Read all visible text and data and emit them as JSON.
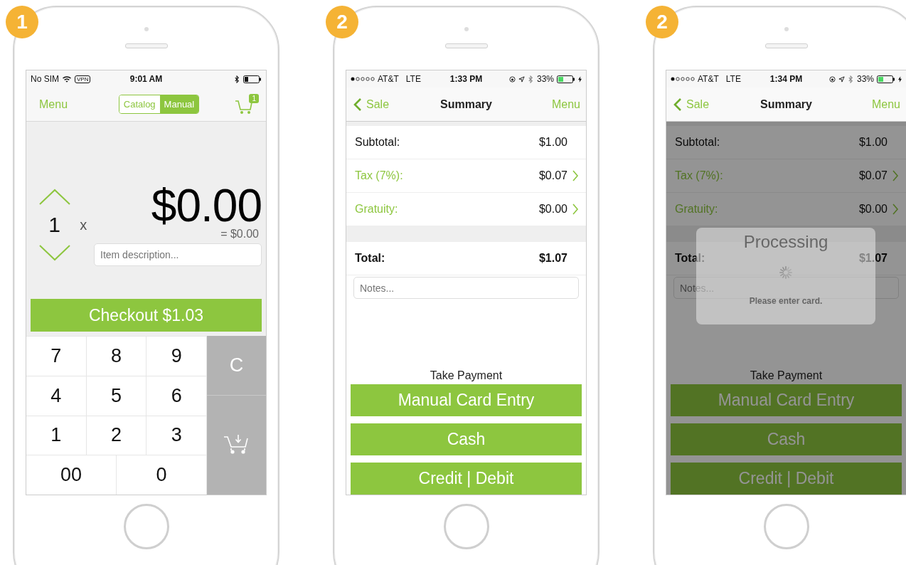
{
  "phones": [
    {
      "badge": "1",
      "kind": "manual",
      "status": {
        "kind": "wifi",
        "carrier": "No SIM",
        "vpn": "VPN",
        "time": "9:01 AM"
      },
      "nav": {
        "left": "Menu",
        "segments": [
          {
            "label": "Catalog",
            "selected": false
          },
          {
            "label": "Manual",
            "selected": true
          }
        ],
        "cart_count": "1"
      },
      "quantity": "1",
      "times": "x",
      "amount": "$0.00",
      "line_total": "= $0.00",
      "description": {
        "placeholder": "Item description..."
      },
      "checkout": "Checkout $1.03",
      "keys": [
        "7",
        "8",
        "9",
        "4",
        "5",
        "6",
        "1",
        "2",
        "3",
        "00",
        "0"
      ],
      "clear": "C"
    },
    {
      "badge": "2",
      "kind": "summary",
      "dimmed": false,
      "status": {
        "kind": "cellular",
        "carrier": "AT&T",
        "network": "LTE",
        "time": "1:33 PM",
        "battery": "33%"
      },
      "nav": {
        "back": "Sale",
        "title": "Summary",
        "right": "Menu"
      },
      "rows": [
        {
          "label": "Subtotal:",
          "value": "$1.00",
          "editable": false
        },
        {
          "label": "Tax (7%):",
          "value": "$0.07",
          "editable": true
        },
        {
          "label": "Gratuity:",
          "value": "$0.00",
          "editable": true
        }
      ],
      "total": {
        "label": "Total:",
        "value": "$1.07"
      },
      "notes": {
        "placeholder": "Notes..."
      },
      "payment_title": "Take Payment",
      "payments": [
        "Manual Card Entry",
        "Cash",
        "Credit | Debit"
      ]
    },
    {
      "badge": "2",
      "kind": "summary",
      "dimmed": true,
      "status": {
        "kind": "cellular",
        "carrier": "AT&T",
        "network": "LTE",
        "time": "1:34 PM",
        "battery": "33%"
      },
      "nav": {
        "back": "Sale",
        "title": "Summary",
        "right": "Menu"
      },
      "rows": [
        {
          "label": "Subtotal:",
          "value": "$1.00",
          "editable": false
        },
        {
          "label": "Tax (7%):",
          "value": "$0.07",
          "editable": true
        },
        {
          "label": "Gratuity:",
          "value": "$0.00",
          "editable": true
        }
      ],
      "total": {
        "label": "Total:",
        "value": "$1.07"
      },
      "notes": {
        "placeholder": "Notes..."
      },
      "payment_title": "Take Payment",
      "payments": [
        "Manual Card Entry",
        "Cash",
        "Credit | Debit"
      ],
      "dialog": {
        "title": "Processing",
        "message": "Please enter card."
      }
    }
  ]
}
